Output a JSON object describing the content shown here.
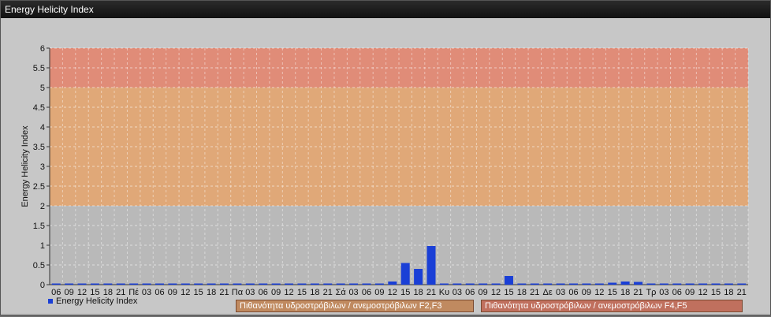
{
  "window": {
    "title": "Energy Helicity Index"
  },
  "chart_data": {
    "type": "bar",
    "ylabel": "Energy Helicity Index",
    "ylim": [
      0,
      6
    ],
    "yticks": [
      "0",
      "0.5",
      "1",
      "1.5",
      "2",
      "2.5",
      "3",
      "3.5",
      "4",
      "4.5",
      "5",
      "5.5",
      "6"
    ],
    "categories": [
      "06",
      "09",
      "12",
      "15",
      "18",
      "21",
      "Πέ",
      "03",
      "06",
      "09",
      "12",
      "15",
      "18",
      "21",
      "Πα",
      "03",
      "06",
      "09",
      "12",
      "15",
      "18",
      "21",
      "Σά",
      "03",
      "06",
      "09",
      "12",
      "15",
      "18",
      "21",
      "Κυ",
      "03",
      "06",
      "09",
      "12",
      "15",
      "18",
      "21",
      "Δε",
      "03",
      "06",
      "09",
      "12",
      "15",
      "18",
      "21",
      "Τρ",
      "03",
      "06",
      "09",
      "12",
      "15",
      "18",
      "21"
    ],
    "series": [
      {
        "name": "Energy Helicity Index",
        "color": "#1a3fd6",
        "values": [
          0,
          0,
          0,
          0,
          0,
          0,
          0,
          0,
          0,
          0,
          0,
          0,
          0,
          0,
          0,
          0,
          0,
          0,
          0,
          0,
          0,
          0,
          0,
          0,
          0,
          0,
          0.08,
          0.55,
          0.4,
          0.98,
          0,
          0,
          0,
          0,
          0,
          0.22,
          0,
          0,
          0,
          0,
          0,
          0,
          0,
          0.05,
          0.08,
          0.07,
          0,
          0,
          0,
          0,
          0,
          0,
          0,
          0
        ]
      }
    ],
    "bands": [
      {
        "from": 0,
        "to": 2,
        "color": "#b9b9b9"
      },
      {
        "from": 2,
        "to": 5,
        "color": "#e0a878"
      },
      {
        "from": 5,
        "to": 6,
        "color": "#e08c78"
      }
    ],
    "band_legend": [
      {
        "label": "Πιθανότητα υδροστρόβιλων / ανεμοστρόβιλων F2,F3",
        "color": "#c08a60"
      },
      {
        "label": "Πιθανότητα υδροστρόβιλων / ανεμοστρόβιλων F4,F5",
        "color": "#c0705e"
      }
    ],
    "grid": true,
    "legend_position": "bottom-left"
  }
}
